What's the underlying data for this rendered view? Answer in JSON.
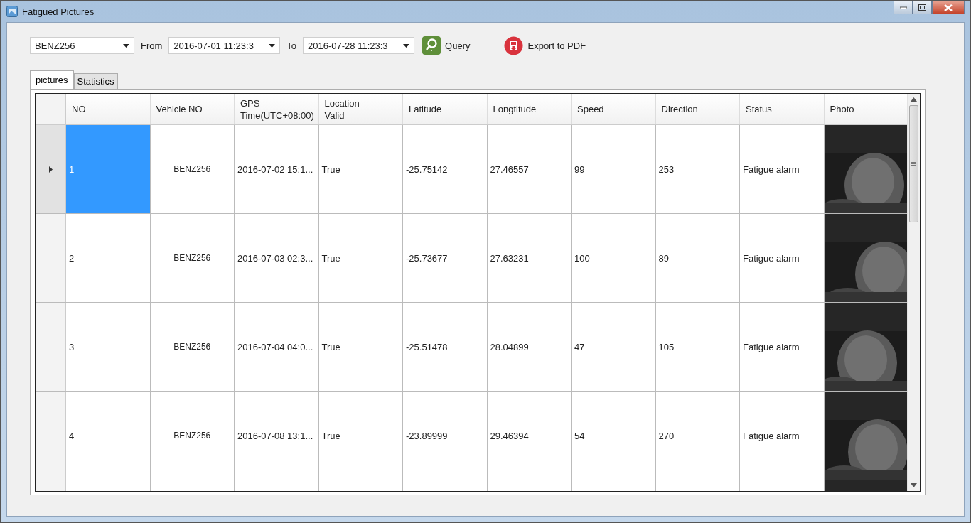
{
  "window": {
    "title": "Fatigued Pictures"
  },
  "toolbar": {
    "vehicle": {
      "value": "BENZ256"
    },
    "from_label": "From",
    "from": {
      "value": "2016-07-01 11:23:3"
    },
    "to_label": "To",
    "to": {
      "value": "2016-07-28 11:23:3"
    },
    "query_button": "Query",
    "export_button": "Export to PDF"
  },
  "tabs": [
    {
      "label": "pictures",
      "selected": true
    },
    {
      "label": "Statistics",
      "selected": false
    }
  ],
  "table": {
    "columns": [
      "NO",
      "Vehicle NO",
      "GPS\nTime(UTC+08:00)",
      "Location\nValid",
      "Latitude",
      "Longtitude",
      "Speed",
      "Direction",
      "Status",
      "Photo"
    ],
    "rows": [
      {
        "selected": true,
        "cells": [
          "1",
          "BENZ256",
          "2016-07-02 15:1...",
          "True",
          "-25.75142",
          "27.46557",
          "99",
          "253",
          "Fatigue alarm"
        ]
      },
      {
        "selected": false,
        "cells": [
          "2",
          "BENZ256",
          "2016-07-03 02:3...",
          "True",
          "-25.73677",
          "27.63231",
          "100",
          "89",
          "Fatigue alarm"
        ]
      },
      {
        "selected": false,
        "cells": [
          "3",
          "BENZ256",
          "2016-07-04 04:0...",
          "True",
          "-25.51478",
          "28.04899",
          "47",
          "105",
          "Fatigue alarm"
        ]
      },
      {
        "selected": false,
        "cells": [
          "4",
          "BENZ256",
          "2016-07-08 13:1...",
          "True",
          "-23.89999",
          "29.46394",
          "54",
          "270",
          "Fatigue alarm"
        ]
      }
    ]
  }
}
